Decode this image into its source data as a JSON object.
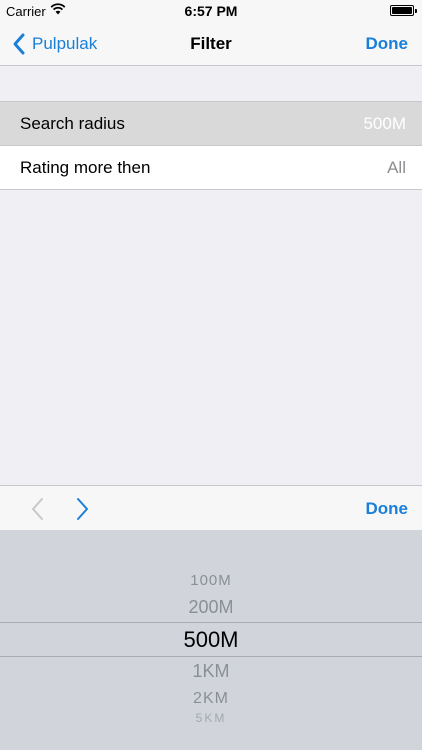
{
  "status_bar": {
    "carrier": "Carrier",
    "time": "6:57 PM",
    "wifi_icon": "wifi-icon",
    "battery_icon": "battery-icon"
  },
  "nav": {
    "back_label": "Pulpulak",
    "title": "Filter",
    "done_label": "Done"
  },
  "filters": [
    {
      "label": "Search radius",
      "value": "500M",
      "selected": true
    },
    {
      "label": "Rating more then",
      "value": "All",
      "selected": false
    }
  ],
  "toolbar": {
    "prev_icon": "chevron-left-icon",
    "next_icon": "chevron-right-icon",
    "done_label": "Done"
  },
  "picker": {
    "options": [
      "100M",
      "200M",
      "500M",
      "1KM",
      "2KM",
      "5KM"
    ],
    "selected": "500M"
  },
  "colors": {
    "accent": "#1a7fd8",
    "background": "#efeff4",
    "selected_row": "#d9d9d9",
    "picker_bg": "#d1d5db"
  }
}
